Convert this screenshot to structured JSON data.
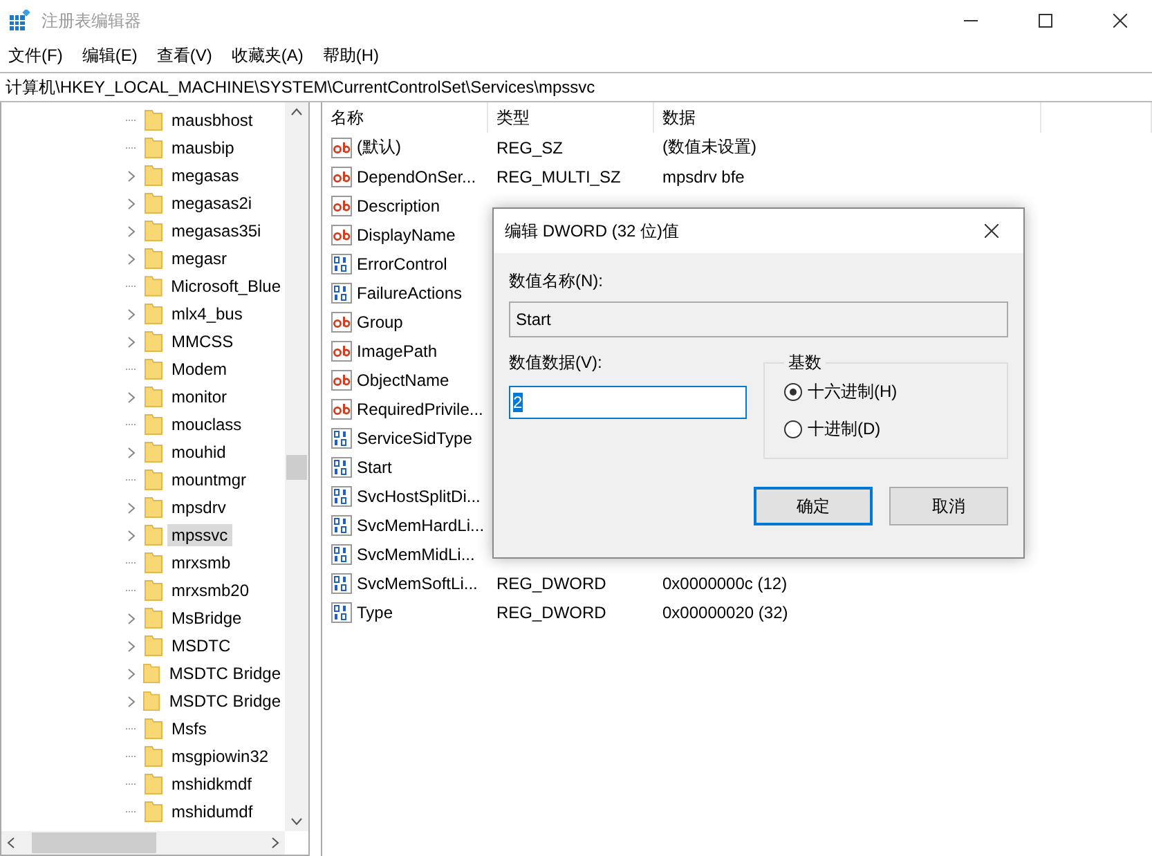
{
  "window": {
    "title": "注册表编辑器"
  },
  "menu": [
    "文件(F)",
    "编辑(E)",
    "查看(V)",
    "收藏夹(A)",
    "帮助(H)"
  ],
  "address": "计算机\\HKEY_LOCAL_MACHINE\\SYSTEM\\CurrentControlSet\\Services\\mpssvc",
  "tree": [
    {
      "name": "mausbhost",
      "expandable": false,
      "selected": false
    },
    {
      "name": "mausbip",
      "expandable": false,
      "selected": false
    },
    {
      "name": "megasas",
      "expandable": true,
      "selected": false
    },
    {
      "name": "megasas2i",
      "expandable": true,
      "selected": false
    },
    {
      "name": "megasas35i",
      "expandable": true,
      "selected": false
    },
    {
      "name": "megasr",
      "expandable": true,
      "selected": false
    },
    {
      "name": "Microsoft_Blue",
      "expandable": false,
      "selected": false
    },
    {
      "name": "mlx4_bus",
      "expandable": true,
      "selected": false
    },
    {
      "name": "MMCSS",
      "expandable": true,
      "selected": false
    },
    {
      "name": "Modem",
      "expandable": false,
      "selected": false
    },
    {
      "name": "monitor",
      "expandable": true,
      "selected": false
    },
    {
      "name": "mouclass",
      "expandable": false,
      "selected": false
    },
    {
      "name": "mouhid",
      "expandable": true,
      "selected": false
    },
    {
      "name": "mountmgr",
      "expandable": false,
      "selected": false
    },
    {
      "name": "mpsdrv",
      "expandable": true,
      "selected": false
    },
    {
      "name": "mpssvc",
      "expandable": true,
      "selected": true
    },
    {
      "name": "mrxsmb",
      "expandable": false,
      "selected": false
    },
    {
      "name": "mrxsmb20",
      "expandable": false,
      "selected": false
    },
    {
      "name": "MsBridge",
      "expandable": true,
      "selected": false
    },
    {
      "name": "MSDTC",
      "expandable": true,
      "selected": false
    },
    {
      "name": "MSDTC Bridge",
      "expandable": true,
      "selected": false
    },
    {
      "name": "MSDTC Bridge",
      "expandable": true,
      "selected": false
    },
    {
      "name": "Msfs",
      "expandable": false,
      "selected": false
    },
    {
      "name": "msgpiowin32",
      "expandable": false,
      "selected": false
    },
    {
      "name": "mshidkmdf",
      "expandable": false,
      "selected": false
    },
    {
      "name": "mshidumdf",
      "expandable": false,
      "selected": false
    }
  ],
  "table": {
    "columns": [
      "名称",
      "类型",
      "数据"
    ],
    "rows": [
      {
        "kind": "string",
        "name": "(默认)",
        "type": "REG_SZ",
        "data": "(数值未设置)"
      },
      {
        "kind": "string",
        "name": "DependOnSer...",
        "type": "REG_MULTI_SZ",
        "data": "mpsdrv bfe"
      },
      {
        "kind": "string",
        "name": "Description"
      },
      {
        "kind": "string",
        "name": "DisplayName"
      },
      {
        "kind": "binary",
        "name": "ErrorControl"
      },
      {
        "kind": "binary",
        "name": "FailureActions"
      },
      {
        "kind": "string",
        "name": "Group"
      },
      {
        "kind": "string",
        "name": "ImagePath"
      },
      {
        "kind": "string",
        "name": "ObjectName"
      },
      {
        "kind": "string",
        "name": "RequiredPrivile..."
      },
      {
        "kind": "binary",
        "name": "ServiceSidType"
      },
      {
        "kind": "binary",
        "name": "Start"
      },
      {
        "kind": "binary",
        "name": "SvcHostSplitDi..."
      },
      {
        "kind": "binary",
        "name": "SvcMemHardLi..."
      },
      {
        "kind": "binary",
        "name": "SvcMemMidLi..."
      },
      {
        "kind": "binary",
        "name": "SvcMemSoftLi...",
        "type": "REG_DWORD",
        "data": "0x0000000c (12)"
      },
      {
        "kind": "binary",
        "name": "Type",
        "type": "REG_DWORD",
        "data": "0x00000020 (32)"
      }
    ]
  },
  "dialog": {
    "title": "编辑 DWORD (32 位)值",
    "name_label": "数值名称(N):",
    "name_value": "Start",
    "data_label": "数值数据(V):",
    "data_value": "2",
    "base_label": "基数",
    "bases": [
      {
        "label": "十六进制(H)",
        "selected": true
      },
      {
        "label": "十进制(D)",
        "selected": false
      }
    ],
    "buttons": [
      {
        "label": "确定",
        "default": true
      },
      {
        "label": "取消",
        "default": false
      }
    ]
  }
}
